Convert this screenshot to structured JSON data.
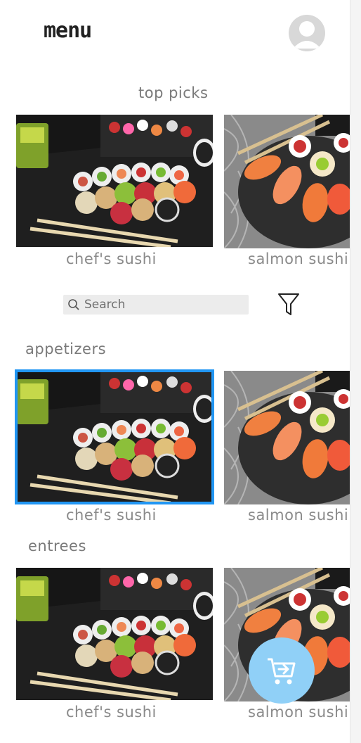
{
  "header": {
    "title": "menu"
  },
  "sections": {
    "top_picks": {
      "title": "top picks",
      "items": [
        {
          "label": "chef's sushi"
        },
        {
          "label": "salmon sushi"
        }
      ]
    },
    "appetizers": {
      "title": "appetizers",
      "items": [
        {
          "label": "chef's sushi"
        },
        {
          "label": "salmon sushi"
        }
      ]
    },
    "entrees": {
      "title": "entrees",
      "items": [
        {
          "label": "chef's sushi"
        },
        {
          "label": "salmon sushi"
        }
      ]
    }
  },
  "search": {
    "placeholder": "Search"
  },
  "icons": {
    "profile": "user-avatar-icon",
    "search": "search-icon",
    "filter": "filter-icon",
    "cart": "add-to-cart-icon"
  },
  "colors": {
    "selected_outline": "#2196f3",
    "cart_button": "#90d0f7"
  }
}
